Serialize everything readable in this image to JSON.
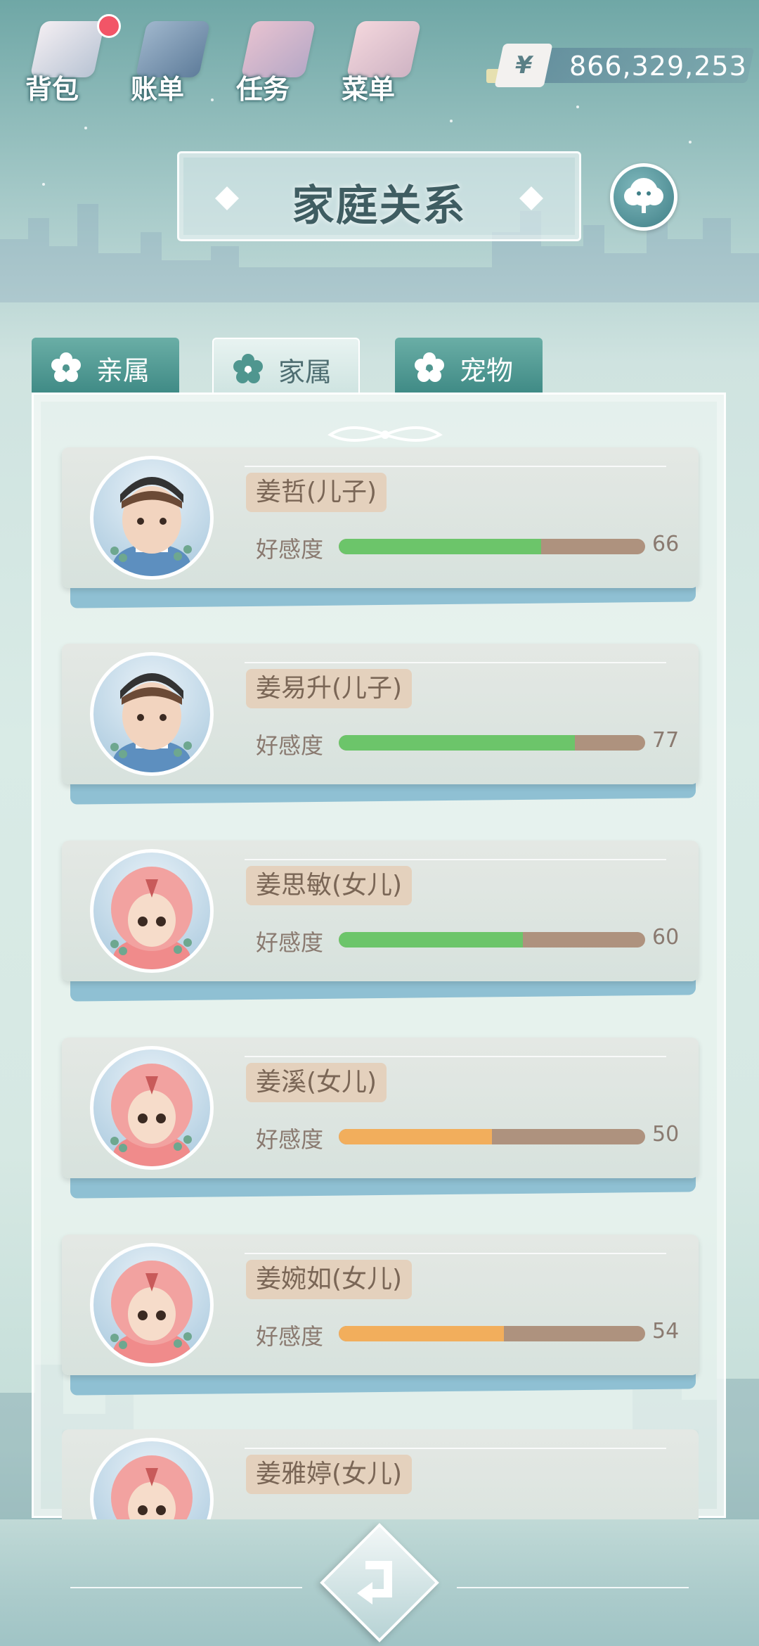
{
  "topbar": {
    "buttons": [
      {
        "label": "背包",
        "icon": "backpack-icon",
        "badge": true
      },
      {
        "label": "账单",
        "icon": "bill-icon",
        "badge": false
      },
      {
        "label": "任务",
        "icon": "task-icon",
        "badge": false
      },
      {
        "label": "菜单",
        "icon": "menu-icon",
        "badge": false
      }
    ],
    "currency_symbol": "¥",
    "money": "866,329,253"
  },
  "title": "家庭关系",
  "tabs": [
    {
      "label": "亲属",
      "active": false
    },
    {
      "label": "家属",
      "active": true
    },
    {
      "label": "宠物",
      "active": false
    }
  ],
  "affection_label": "好感度",
  "members": [
    {
      "name": "姜哲(儿子)",
      "affection": 66,
      "gender": "boy"
    },
    {
      "name": "姜易升(儿子)",
      "affection": 77,
      "gender": "boy"
    },
    {
      "name": "姜思敏(女儿)",
      "affection": 60,
      "gender": "girl"
    },
    {
      "name": "姜溪(女儿)",
      "affection": 50,
      "gender": "girl"
    },
    {
      "name": "姜婉如(女儿)",
      "affection": 54,
      "gender": "girl"
    },
    {
      "name": "姜雅婷(女儿)",
      "affection": null,
      "gender": "girl"
    }
  ],
  "colors": {
    "bar_high": "#6cc56a",
    "bar_mid": "#f2ae5c",
    "bar_track": "#ae927e",
    "badge": "#f25567"
  }
}
